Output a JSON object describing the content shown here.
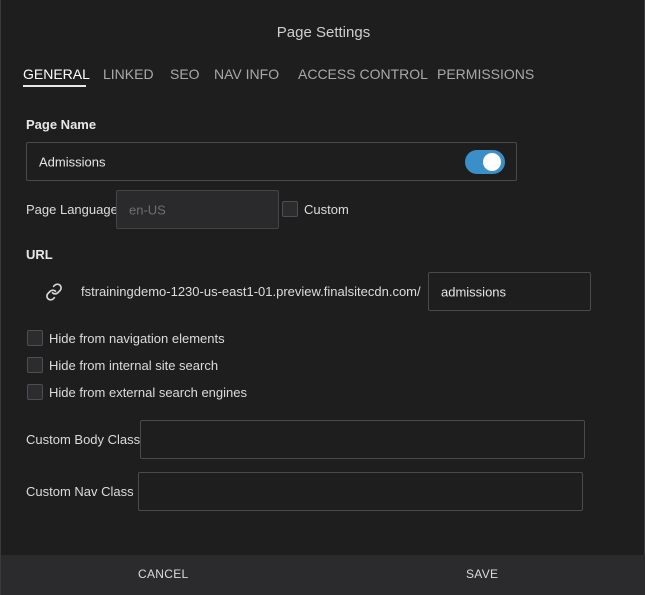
{
  "dialog": {
    "title": "Page Settings"
  },
  "tabs": [
    {
      "label": "GENERAL",
      "active": true
    },
    {
      "label": "LINKED",
      "active": false
    },
    {
      "label": "SEO",
      "active": false
    },
    {
      "label": "NAV INFO",
      "active": false
    },
    {
      "label": "ACCESS CONTROL",
      "active": false
    },
    {
      "label": "PERMISSIONS",
      "active": false
    }
  ],
  "page_name": {
    "label": "Page Name",
    "value": "Admissions",
    "toggle_on": true
  },
  "page_language": {
    "label": "Page Language",
    "placeholder": "en-US",
    "custom_label": "Custom",
    "custom_checked": false
  },
  "url": {
    "label": "URL",
    "prefix": "fstrainingdemo-1230-us-east1-01.preview.finalsitecdn.com/",
    "slug": "admissions"
  },
  "options": [
    {
      "label": "Hide from navigation elements",
      "checked": false
    },
    {
      "label": "Hide from internal site search",
      "checked": false
    },
    {
      "label": "Hide from external search engines",
      "checked": false
    }
  ],
  "custom_body_class": {
    "label": "Custom Body Class",
    "value": ""
  },
  "custom_nav_class": {
    "label": "Custom Nav Class",
    "value": ""
  },
  "footer": {
    "cancel_label": "CANCEL",
    "save_label": "SAVE"
  },
  "colors": {
    "accent": "#3b8fc9",
    "background": "#1e1e1f",
    "footer": "#2b2b2d"
  },
  "icons": {
    "url": "link-icon"
  }
}
